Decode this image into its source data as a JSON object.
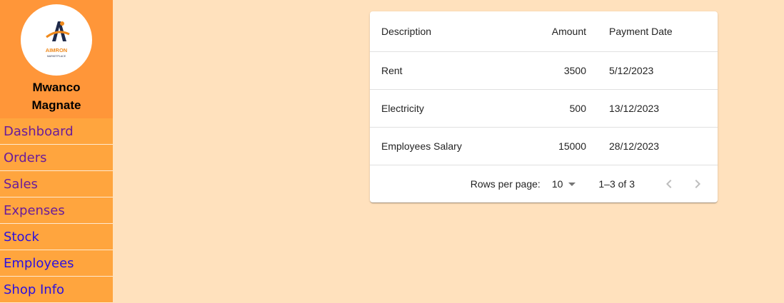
{
  "sidebar": {
    "logo": {
      "brand": "AIMRON",
      "subtitle": "MARKETPLACE"
    },
    "shop_name": "Mwanco Magnate",
    "items": [
      {
        "label": "Dashboard"
      },
      {
        "label": "Orders"
      },
      {
        "label": "Sales"
      },
      {
        "label": "Expenses"
      },
      {
        "label": "Stock"
      },
      {
        "label": "Employees"
      },
      {
        "label": "Shop Info"
      }
    ]
  },
  "table": {
    "headers": {
      "description": "Description",
      "amount": "Amount",
      "payment_date": "Payment Date"
    },
    "rows": [
      {
        "description": "Rent",
        "amount": "3500",
        "payment_date": "5/12/2023"
      },
      {
        "description": "Electricity",
        "amount": "500",
        "payment_date": "13/12/2023"
      },
      {
        "description": "Employees Salary",
        "amount": "15000",
        "payment_date": "28/12/2023"
      }
    ],
    "pagination": {
      "rows_per_page_label": "Rows per page:",
      "rows_per_page": "10",
      "range": "1–3 of 3"
    }
  },
  "colors": {
    "background": "#FFE1BD",
    "sidebar": "#FFA53E",
    "sidebar_header": "#FF9639",
    "visited_link": "#6A1B9A",
    "link": "#2A0FE0"
  }
}
